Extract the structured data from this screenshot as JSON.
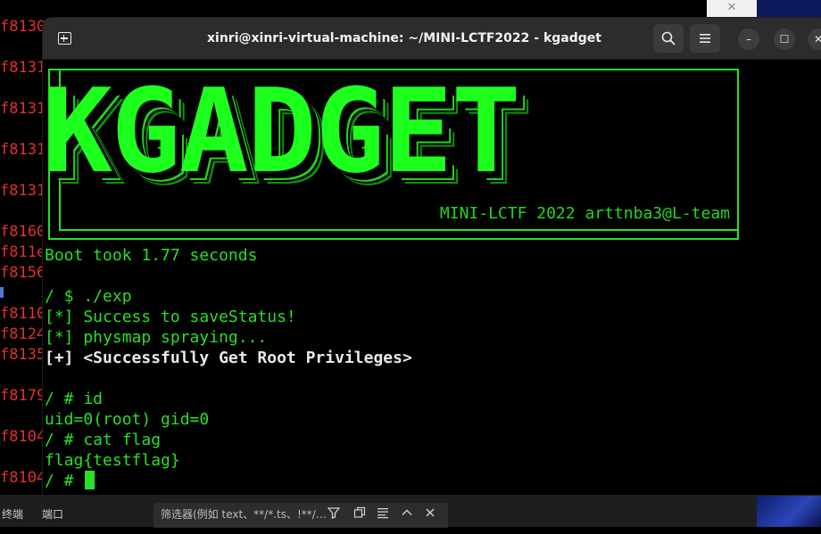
{
  "background_editor": {
    "gutter_lines": [
      {
        "text": "f8130"
      },
      {
        "text": "f8131"
      },
      {
        "text": "f8131"
      },
      {
        "text": "f8131"
      },
      {
        "text": "f8131"
      },
      {
        "text": "f8160"
      },
      {
        "text": "f811e"
      },
      {
        "text": "f8156"
      },
      {
        "text": "f8110"
      },
      {
        "text": "f8124"
      },
      {
        "text": "f8135"
      },
      {
        "text": "f8179"
      },
      {
        "text": "f8104"
      },
      {
        "text": "f8104"
      }
    ],
    "gutter_color": "#e03131"
  },
  "window": {
    "title": "xinri@xinri-virtual-machine: ~/MINI-LCTF2022 - kgadget",
    "new_tab_icon": "new-tab-icon",
    "search_icon": "search-icon",
    "menu_icon": "hamburger-menu-icon",
    "minimize_symbol": "–",
    "maximize_symbol": "☐",
    "close_symbol": "✕"
  },
  "terminal": {
    "banner_title": "KGADGET",
    "banner_subtitle": "MINI-LCTF 2022 arttnba3@L-team",
    "lines": [
      {
        "text": "Boot took 1.77 seconds",
        "style": "normal"
      },
      {
        "text": "",
        "style": "normal"
      },
      {
        "text": "/ $ ./exp",
        "style": "normal"
      },
      {
        "text": "[*] Success to saveStatus!",
        "style": "normal"
      },
      {
        "text": "[*] physmap spraying...",
        "style": "normal"
      },
      {
        "text": "[+] <Successfully Get Root Privileges>",
        "style": "bold"
      },
      {
        "text": "",
        "style": "normal"
      },
      {
        "text": "/ # id",
        "style": "normal"
      },
      {
        "text": "uid=0(root) gid=0",
        "style": "normal"
      },
      {
        "text": "/ # cat flag",
        "style": "normal"
      },
      {
        "text": "flag{testflag}",
        "style": "normal"
      },
      {
        "text": "/ # ",
        "style": "prompt"
      }
    ],
    "text_color": "#27e027",
    "bold_color": "#e8e8e8"
  },
  "bottom_panel": {
    "tab_terminal": "终端",
    "tab_ports": "端口",
    "filter_placeholder": "筛选器(例如 text、**/*.ts、!**/…",
    "icons": [
      "filter-icon",
      "collapse-icon",
      "list-icon",
      "chevron-up-icon",
      "close-icon"
    ]
  },
  "desktop": {
    "top_right_close": "✕"
  }
}
